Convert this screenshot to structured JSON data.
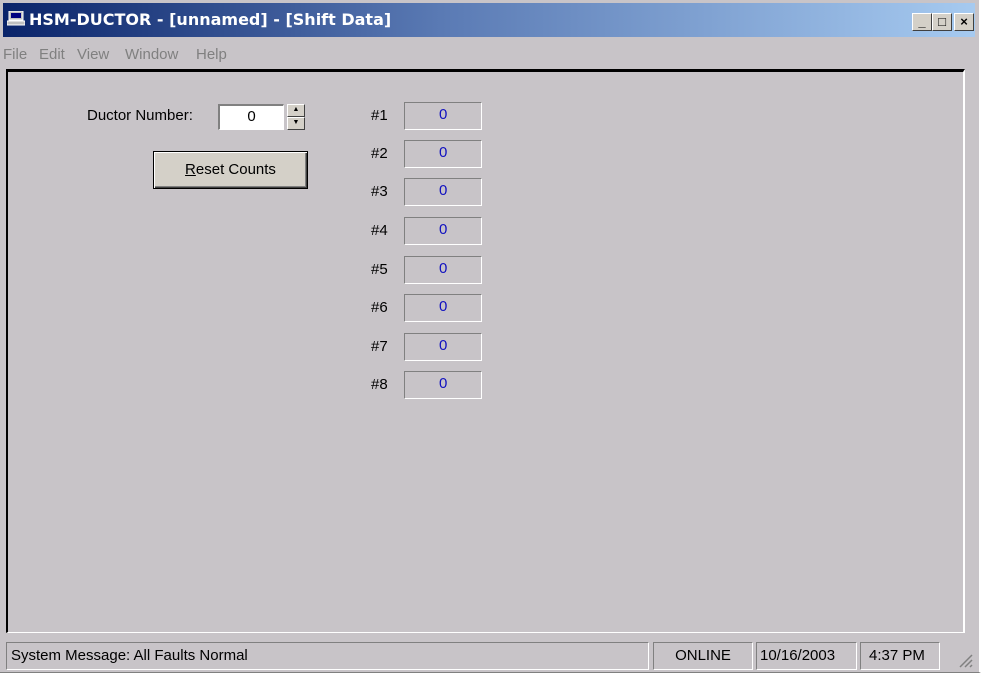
{
  "window": {
    "title": "HSM-DUCTOR - [unnamed] - [Shift Data]",
    "controls": {
      "minimize": "_",
      "maximize": "□",
      "close": "×"
    }
  },
  "menu": [
    "File",
    "Edit",
    "View",
    "Window",
    "Help"
  ],
  "form": {
    "ductor_label": "Ductor Number:",
    "ductor_value": "0",
    "reset_button": {
      "accel": "R",
      "rest": "eset Counts"
    }
  },
  "counts": [
    {
      "label": "#1",
      "value": "0"
    },
    {
      "label": "#2",
      "value": "0"
    },
    {
      "label": "#3",
      "value": "0"
    },
    {
      "label": "#4",
      "value": "0"
    },
    {
      "label": "#5",
      "value": "0"
    },
    {
      "label": "#6",
      "value": "0"
    },
    {
      "label": "#7",
      "value": "0"
    },
    {
      "label": "#8",
      "value": "0"
    }
  ],
  "statusbar": {
    "message": "System Message:  All Faults Normal",
    "state": "ONLINE",
    "date": "10/16/2003",
    "time": "4:37 PM"
  },
  "colors": {
    "title_gradient_start": "#0a246a",
    "title_gradient_end": "#a6caf0",
    "count_value": "#1010c0",
    "background": "#c8c4c8"
  },
  "icons": [
    "computer-app-icon",
    "spin-up-icon",
    "spin-down-icon",
    "resize-grip-icon"
  ]
}
